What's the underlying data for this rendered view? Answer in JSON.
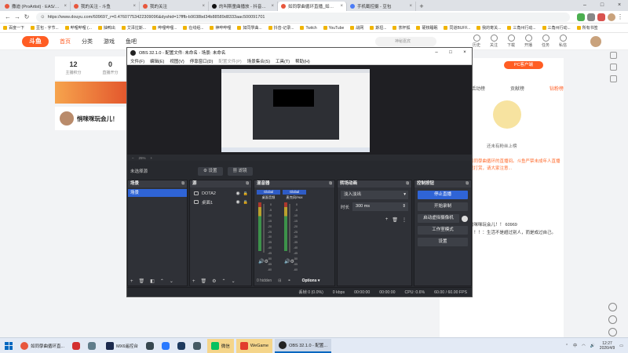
{
  "browser": {
    "tabs": [
      {
        "title": "撒迪 (ProArtist) · EAS/三二...",
        "active": false
      },
      {
        "title": "我的关注 - 斗鱼",
        "active": false
      },
      {
        "title": "我的关注",
        "active": false
      },
      {
        "title": "的叫斯童曲播放 - 抖音直播",
        "active": false
      },
      {
        "title": "如同學曲循环直播_如同學曲...",
        "active": true
      },
      {
        "title": "手机截控摄 - 豆包",
        "active": false
      }
    ],
    "url": "https://www.douyu.com/609697_r=0.47607753422309096&dyshid=17fffb-b9038bd34b88589d8333aac500091701",
    "bookmarks": [
      "百度一下",
      "豆包 - 字节...",
      "哔哩哔哩 (...",
      "抽鸭出",
      "艾泽拉斯...",
      "哔哩哔哩...",
      "在线组...",
      "神哔哔哩",
      "如同學曲...",
      "抖音-记录...",
      "Twitch",
      "YouTube",
      "战网",
      "斯坦...",
      "茶杯狐",
      "硬核睡眠",
      "同道BUFF...",
      "我的寄关...",
      "三角州行动...",
      "三角州行动...",
      "所有书签"
    ]
  },
  "site": {
    "nav": [
      "首页",
      "分类",
      "游戏",
      "鱼吧"
    ],
    "search_placeholder": "神秘嘉宾",
    "header_icons": [
      "历史",
      "关注",
      "下载",
      "开播",
      "任务",
      "私信"
    ],
    "stats": [
      {
        "n": "12",
        "l": "主播积分"
      },
      {
        "n": "0",
        "l": "直播开分"
      }
    ],
    "streamer_name": "悄咪咪玩会儿！",
    "pc_client": "PC客户端",
    "right_tabs": [
      "活动榜",
      "贡献榜",
      "钻粉榜"
    ],
    "mascot_tip": "还未有粉丝上榜",
    "right_orange_text": "如同學曲循环的直播间。斗鱼严禁未成年人直播或打赏，请大家注意...",
    "right_line1": "悄咪咪玩会儿！！ 60969",
    "right_line2": "！！！：生活不是超过别人，而是成过自己。"
  },
  "obs": {
    "title": "OBS 32.1.0 - 配置文件: 未命名 - 场景: 未命名",
    "menu": [
      "文件(F)",
      "编辑(E)",
      "视图(V)",
      "停靠窗口(D)",
      "配置文件(P)",
      "场景集合(S)",
      "工具(T)",
      "帮助(H)"
    ],
    "zoom": "25%",
    "source_bar": {
      "label": "未选择源",
      "settings": "设置",
      "filters": "滤镜"
    },
    "docks": {
      "scenes": "场景",
      "sources": "源",
      "mixer": "混音器",
      "transitions": "转场动画",
      "controls": "控制按钮"
    },
    "scenes": [
      "场景"
    ],
    "sources": [
      "DOTA2",
      "桌面1"
    ],
    "mixer": {
      "channels": [
        {
          "name": "Global",
          "device": "桌面音频",
          "db": "0.0 dB"
        },
        {
          "name": "Global",
          "device": "麦克风/Aux",
          "db": "0.0 dB"
        }
      ],
      "scale": [
        "0",
        "-5",
        "-10",
        "-15",
        "-20",
        "-25",
        "-30",
        "-35",
        "-40",
        "-45",
        "-50",
        "-55",
        "-60"
      ],
      "hidden": "0 hidden",
      "options": "Options"
    },
    "transition": {
      "type": "淡入淡出",
      "duration_label": "时长",
      "duration": "300 ms"
    },
    "controls": [
      "停止直播",
      "开始录制",
      "启动虚拟摄像机",
      "工作室模式",
      "设置"
    ],
    "status": {
      "dropped": "丢帧 0 (0.0%)",
      "kbps": "0 kbps",
      "stream_time": "00:00:00",
      "rec_time": "00:00:00",
      "cpu": "CPU: 0.6%",
      "fps": "60.00 / 60.00 FPS"
    }
  },
  "taskbar": {
    "items": [
      {
        "label": "如同學曲循环直...",
        "active": false,
        "color": "#e8573d"
      },
      {
        "label": "MX6遥控台",
        "active": false,
        "color": "#1c2a4d"
      },
      {
        "label": "微信",
        "active": false,
        "color": "#07c160"
      },
      {
        "label": "WeGame",
        "active": false,
        "color": "#e23c2d"
      },
      {
        "label": "OBS 32.1.0 - 配置...",
        "active": true,
        "color": "#222222"
      }
    ],
    "time": "12:27",
    "date": "2026/4/9",
    "lang": "中"
  }
}
